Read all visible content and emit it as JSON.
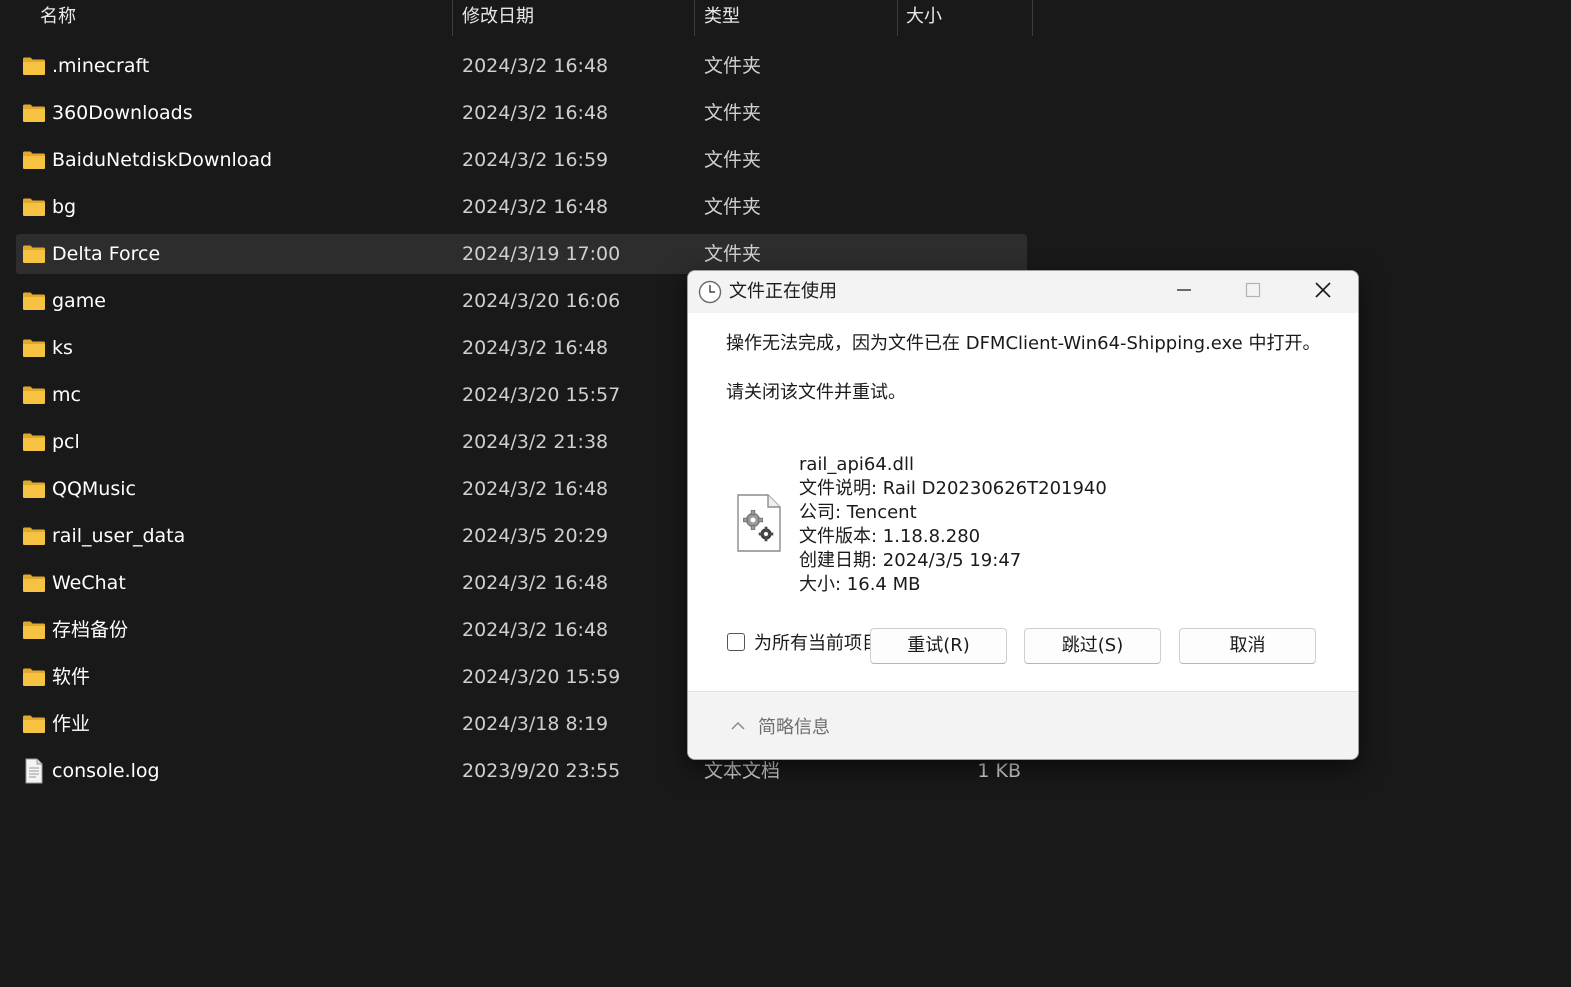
{
  "explorer": {
    "columns": {
      "name": "名称",
      "date": "修改日期",
      "type": "类型",
      "size": "大小"
    },
    "files": [
      {
        "name": ".minecraft",
        "date": "2024/3/2 16:48",
        "type": "文件夹",
        "size": "",
        "kind": "folder",
        "selected": false
      },
      {
        "name": "360Downloads",
        "date": "2024/3/2 16:48",
        "type": "文件夹",
        "size": "",
        "kind": "folder",
        "selected": false
      },
      {
        "name": "BaiduNetdiskDownload",
        "date": "2024/3/2 16:59",
        "type": "文件夹",
        "size": "",
        "kind": "folder",
        "selected": false
      },
      {
        "name": "bg",
        "date": "2024/3/2 16:48",
        "type": "文件夹",
        "size": "",
        "kind": "folder",
        "selected": false
      },
      {
        "name": "Delta Force",
        "date": "2024/3/19 17:00",
        "type": "文件夹",
        "size": "",
        "kind": "folder",
        "selected": true
      },
      {
        "name": "game",
        "date": "2024/3/20 16:06",
        "type": "",
        "size": "",
        "kind": "folder",
        "selected": false
      },
      {
        "name": "ks",
        "date": "2024/3/2 16:48",
        "type": "",
        "size": "",
        "kind": "folder",
        "selected": false
      },
      {
        "name": "mc",
        "date": "2024/3/20 15:57",
        "type": "",
        "size": "",
        "kind": "folder",
        "selected": false
      },
      {
        "name": "pcl",
        "date": "2024/3/2 21:38",
        "type": "",
        "size": "",
        "kind": "folder",
        "selected": false
      },
      {
        "name": "QQMusic",
        "date": "2024/3/2 16:48",
        "type": "",
        "size": "",
        "kind": "folder",
        "selected": false
      },
      {
        "name": "rail_user_data",
        "date": "2024/3/5 20:29",
        "type": "",
        "size": "",
        "kind": "folder",
        "selected": false
      },
      {
        "name": "WeChat",
        "date": "2024/3/2 16:48",
        "type": "",
        "size": "",
        "kind": "folder",
        "selected": false
      },
      {
        "name": "存档备份",
        "date": "2024/3/2 16:48",
        "type": "",
        "size": "",
        "kind": "folder",
        "selected": false
      },
      {
        "name": "软件",
        "date": "2024/3/20 15:59",
        "type": "",
        "size": "",
        "kind": "folder",
        "selected": false
      },
      {
        "name": "作业",
        "date": "2024/3/18 8:19",
        "type": "",
        "size": "",
        "kind": "folder",
        "selected": false
      },
      {
        "name": "console.log",
        "date": "2023/9/20 23:55",
        "type": "文本文档",
        "size": "1 KB",
        "kind": "file",
        "selected": false
      }
    ],
    "colors": {
      "background": "#191919",
      "folder": "#f5c242",
      "selected_row": "#2d2d2d"
    }
  },
  "dialog": {
    "title": "文件正在使用",
    "message": "操作无法完成，因为文件已在 DFMClient-Win64-Shipping.exe 中打开。",
    "instruction": "请关闭该文件并重试。",
    "file_info": {
      "name": "rail_api64.dll",
      "description": "文件说明: Rail D20230626T201940",
      "company": "公司: Tencent",
      "version": "文件版本: 1.18.8.280",
      "created": "创建日期: 2024/3/5 19:47",
      "size": "大小: 16.4 MB"
    },
    "checkbox_label": "为所有当前项目执行此操作(A)",
    "checkbox_checked": false,
    "buttons": {
      "retry": "重试(R)",
      "skip": "跳过(S)",
      "cancel": "取消"
    },
    "details_label": "简略信息",
    "icons": {
      "title": "clock-icon",
      "file": "dll-settings-file-icon",
      "minimize": "minimize-icon",
      "maximize": "maximize-icon",
      "close": "close-icon",
      "details": "chevron-up-icon"
    }
  }
}
